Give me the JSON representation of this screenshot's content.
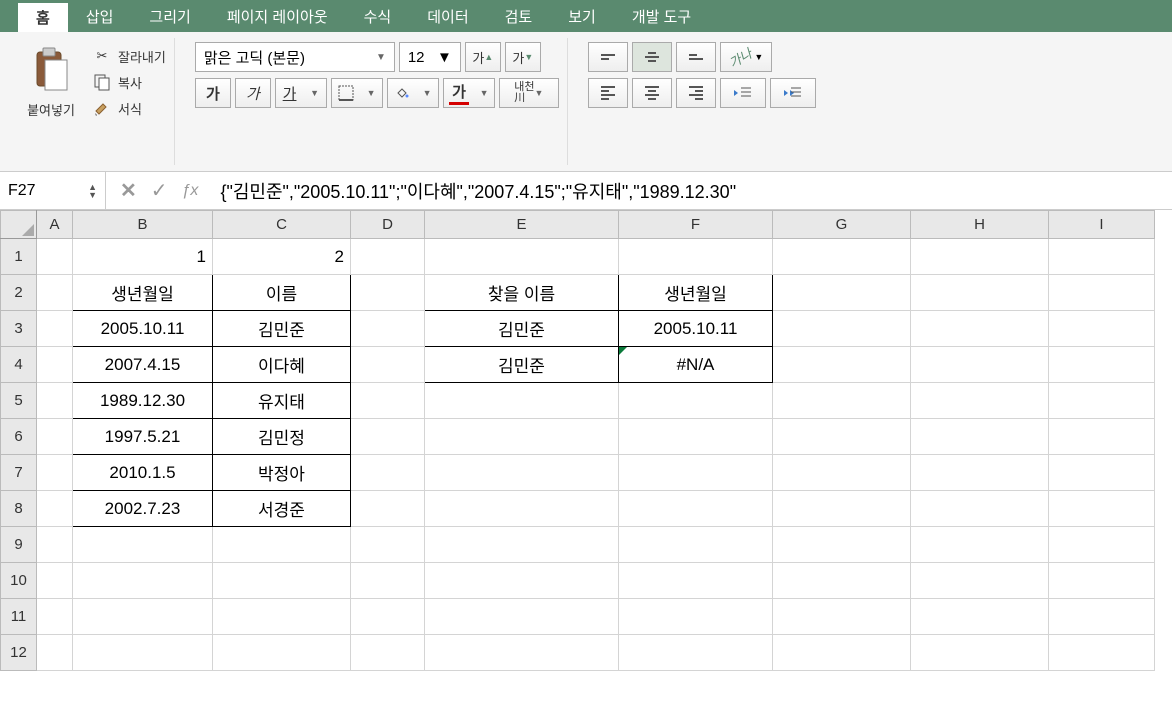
{
  "ribbon": {
    "tabs": [
      "홈",
      "삽입",
      "그리기",
      "페이지 레이아웃",
      "수식",
      "데이터",
      "검토",
      "보기",
      "개발 도구"
    ],
    "active_tab_index": 0,
    "clipboard": {
      "paste": "붙여넣기",
      "cut": "잘라내기",
      "copy": "복사",
      "format": "서식"
    },
    "font": {
      "family": "맑은 고딕 (본문)",
      "size": "12",
      "inc": "가▲",
      "dec": "가▼",
      "bold": "가",
      "italic": "가",
      "underline": "가",
      "fill": "",
      "color": "가",
      "wrap": "내천 川"
    }
  },
  "formula_bar": {
    "name_box": "F27",
    "formula": "{\"김민준\",\"2005.10.11\";\"이다혜\",\"2007.4.15\";\"유지태\",\"1989.12.30\""
  },
  "grid": {
    "cols": [
      "A",
      "B",
      "C",
      "D",
      "E",
      "F",
      "G",
      "H",
      "I"
    ],
    "rows": 12,
    "cells": {
      "B1": "1",
      "C1": "2",
      "B2": "생년월일",
      "C2": "이름",
      "B3": "2005.10.11",
      "C3": "김민준",
      "B4": "2007.4.15",
      "C4": "이다혜",
      "B5": "1989.12.30",
      "C5": "유지태",
      "B6": "1997.5.21",
      "C6": "김민정",
      "B7": "2010.1.5",
      "C7": "박정아",
      "B8": "2002.7.23",
      "C8": "서경준",
      "E2": "찾을 이름",
      "F2": "생년월일",
      "E3": "김민준",
      "F3": "2005.10.11",
      "E4": "김민준",
      "F4": "#N/A"
    }
  }
}
